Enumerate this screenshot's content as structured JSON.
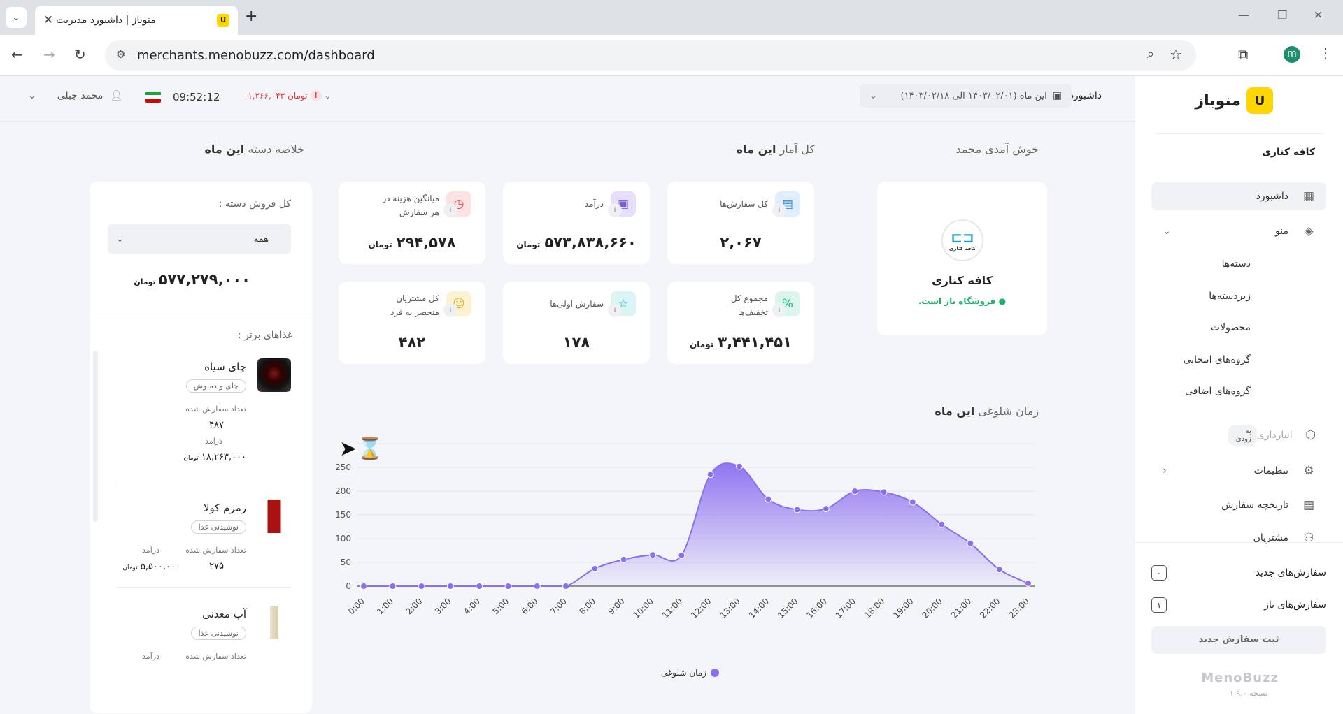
{
  "browser": {
    "tab_title": "منوباز | داشبورد مدیریت",
    "url": "merchants.menobuzz.com/dashboard",
    "profile_initial": "m"
  },
  "sidebar": {
    "logo_text": "منوباز",
    "cafe_name": "کافه کناری",
    "nav": [
      {
        "label": "داشبورد",
        "icon": "grid-icon"
      },
      {
        "label": "منو",
        "icon": "layers-icon"
      },
      {
        "label": "انبارداری",
        "icon": "box-icon",
        "badge": "به زودی"
      },
      {
        "label": "تنظیمات",
        "icon": "gear-icon"
      },
      {
        "label": "تاریخچه سفارش",
        "icon": "document-icon"
      },
      {
        "label": "مشتریان",
        "icon": "users-icon"
      }
    ],
    "menu_sub": [
      "دسته‌ها",
      "زیردسته‌ها",
      "محصولات",
      "گروه‌های انتخابی",
      "گروه‌های اضافی"
    ],
    "new_orders_label": "سفارش‌های جدید",
    "new_orders_count": "۰",
    "open_orders_label": "سفارش‌های باز",
    "open_orders_count": "۱",
    "new_order_button": "ثبت سفارش جدید",
    "footer_brand": "MenoBuzz",
    "version": "نسخه ۱.۹.۰"
  },
  "header": {
    "breadcrumb": "داشبورد",
    "date_range": "این ماه (۱۴۰۳/۰۲/۰۱ الی ۱۴۰۳/۰۲/۱۸)",
    "balance": "-۱,۲۶۶,۰۴۳",
    "balance_unit": "تومان",
    "time": "09:52:12",
    "user_name": "محمد جبلی"
  },
  "titles": {
    "welcome": "خوش آمدی محمد",
    "stats_prefix": "کل آمار",
    "stats_bold": "این ماه",
    "summary_prefix": "خلاصه دسته",
    "summary_bold": "این ماه",
    "busy_prefix": "زمان شلوغی",
    "busy_bold": "این ماه"
  },
  "shop": {
    "name": "کافه کناری",
    "status": "فروشگاه باز است."
  },
  "stats": {
    "total_orders": {
      "label": "کل سفارش‌ها",
      "value": "۲,۰۶۷"
    },
    "revenue": {
      "label": "درآمد",
      "value": "۵۷۳,۸۳۸,۶۶۰",
      "unit": "تومان"
    },
    "avg_cost": {
      "label": "میانگین هزینه در هر سفارش",
      "value": "۲۹۴,۵۷۸",
      "unit": "تومان"
    },
    "discounts": {
      "label": "مجموع کل تخفیف‌ها",
      "value": "۳,۴۴۱,۴۵۱",
      "unit": "تومان"
    },
    "first_orders": {
      "label": "سفارش اولی‌ها",
      "value": "۱۷۸"
    },
    "unique_customers": {
      "label": "کل مشتریان منحصر به فرد",
      "value": "۴۸۲"
    },
    "info_glyph": "i"
  },
  "summary": {
    "total_sales_label": "کل فروش دسته :",
    "select_value": "همه",
    "total": "۵۷۷,۲۷۹,۰۰۰",
    "unit": "تومان",
    "top_foods_label": "غذاهای برتر :",
    "foods": [
      {
        "name": "چای سیاه",
        "category": "چای و دمنوش",
        "orders_label": "تعداد سفارش شده",
        "orders": "۴۸۷",
        "revenue_label": "درآمد",
        "revenue": "۱۸,۲۶۳,۰۰۰"
      },
      {
        "name": "زمزم کولا",
        "category": "نوشیدنی غذا",
        "orders_label": "تعداد سفارش شده",
        "orders": "۲۷۵",
        "revenue_label": "درآمد",
        "revenue": "۵,۵۰۰,۰۰۰"
      },
      {
        "name": "آب معدنی",
        "category": "نوشیدنی غذا",
        "orders_label": "تعداد سفارش شده",
        "orders": "",
        "revenue_label": "درآمد",
        "revenue": ""
      }
    ]
  },
  "colors": {
    "accent": "#8b6ff0",
    "brand_yellow": "#ffd600",
    "success": "#18b26b",
    "danger": "#e53935"
  },
  "chart_data": {
    "type": "area",
    "x": [
      "0:00",
      "1:00",
      "2:00",
      "3:00",
      "4:00",
      "5:00",
      "6:00",
      "7:00",
      "8:00",
      "9:00",
      "10:00",
      "11:00",
      "12:00",
      "13:00",
      "14:00",
      "15:00",
      "16:00",
      "17:00",
      "18:00",
      "19:00",
      "20:00",
      "21:00",
      "22:00",
      "23:00"
    ],
    "series": [
      {
        "name": "زمان شلوغی",
        "values": [
          0,
          0,
          0,
          0,
          0,
          0,
          0,
          0,
          37,
          56,
          66,
          65,
          235,
          252,
          183,
          161,
          163,
          200,
          198,
          177,
          130,
          90,
          35,
          6
        ]
      }
    ],
    "ylim": [
      0,
      300
    ],
    "yticks": [
      0,
      50,
      100,
      150,
      200,
      250
    ],
    "grid": true,
    "legend": "bottom"
  }
}
